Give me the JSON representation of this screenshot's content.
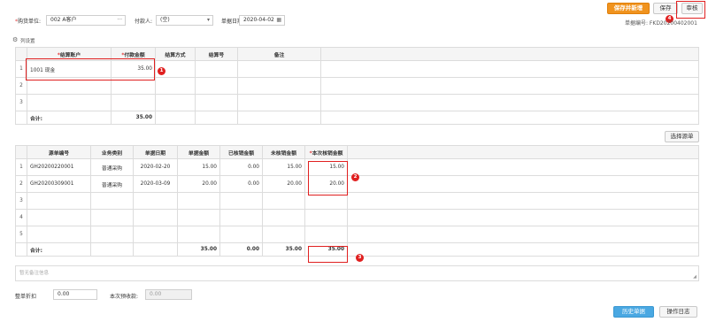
{
  "toolbar": {
    "save_new": "保存并新增",
    "save": "保存",
    "audit": "审核"
  },
  "header": {
    "buyer_label": "购货单位:",
    "buyer_value": "002 A客户",
    "buyer_more": "···",
    "payee_label": "付款人:",
    "payee_value": "(空)",
    "date_label": "单据日期:",
    "date_value": "2020-04-02",
    "docno_text": "单据编号: FKD20200402001"
  },
  "settings_label": "列设置",
  "settlement": {
    "columns": [
      "",
      "结算账户",
      "付款金额",
      "结算方式",
      "结算号",
      "备注"
    ],
    "rows": [
      {
        "idx": "1",
        "account": "1001 现金",
        "amount": "35.00",
        "method": "",
        "no": "",
        "note": ""
      },
      {
        "idx": "2",
        "account": "",
        "amount": "",
        "method": "",
        "no": "",
        "note": ""
      },
      {
        "idx": "3",
        "account": "",
        "amount": "",
        "method": "",
        "no": "",
        "note": ""
      }
    ],
    "total_label": "合计:",
    "total_amount": "35.00"
  },
  "select_source_button": "选择源单",
  "source": {
    "columns": [
      "",
      "源单编号",
      "业务类别",
      "单据日期",
      "单据金额",
      "已核销金额",
      "未核销金额",
      "本次核销金额"
    ],
    "rows": [
      {
        "idx": "1",
        "no": "GH20200220001",
        "type": "普通采购",
        "date": "2020-02-20",
        "amount": "15.00",
        "verified": "0.00",
        "unverified": "15.00",
        "current": "15.00"
      },
      {
        "idx": "2",
        "no": "GH20200309001",
        "type": "普通采购",
        "date": "2020-03-09",
        "amount": "20.00",
        "verified": "0.00",
        "unverified": "20.00",
        "current": "20.00"
      },
      {
        "idx": "3",
        "no": "",
        "type": "",
        "date": "",
        "amount": "",
        "verified": "",
        "unverified": "",
        "current": ""
      },
      {
        "idx": "4",
        "no": "",
        "type": "",
        "date": "",
        "amount": "",
        "verified": "",
        "unverified": "",
        "current": ""
      },
      {
        "idx": "5",
        "no": "",
        "type": "",
        "date": "",
        "amount": "",
        "verified": "",
        "unverified": "",
        "current": ""
      }
    ],
    "total_label": "合计:",
    "total_amount": "35.00",
    "total_verified": "0.00",
    "total_unverified": "35.00",
    "total_current": "35.00"
  },
  "remark_placeholder": "暂无备注信息",
  "footer": {
    "discount_label": "整单折扣",
    "discount_value": "0.00",
    "prepay_label": "本次预收款:",
    "prepay_value": "0.00",
    "history_button": "历史单据",
    "log_button": "操作日志"
  },
  "markers": [
    "1",
    "2",
    "3",
    "4"
  ],
  "colors": {
    "accent_orange": "#f0931e",
    "annotation_red": "#e02020",
    "blue_button": "#4aa8e2"
  }
}
